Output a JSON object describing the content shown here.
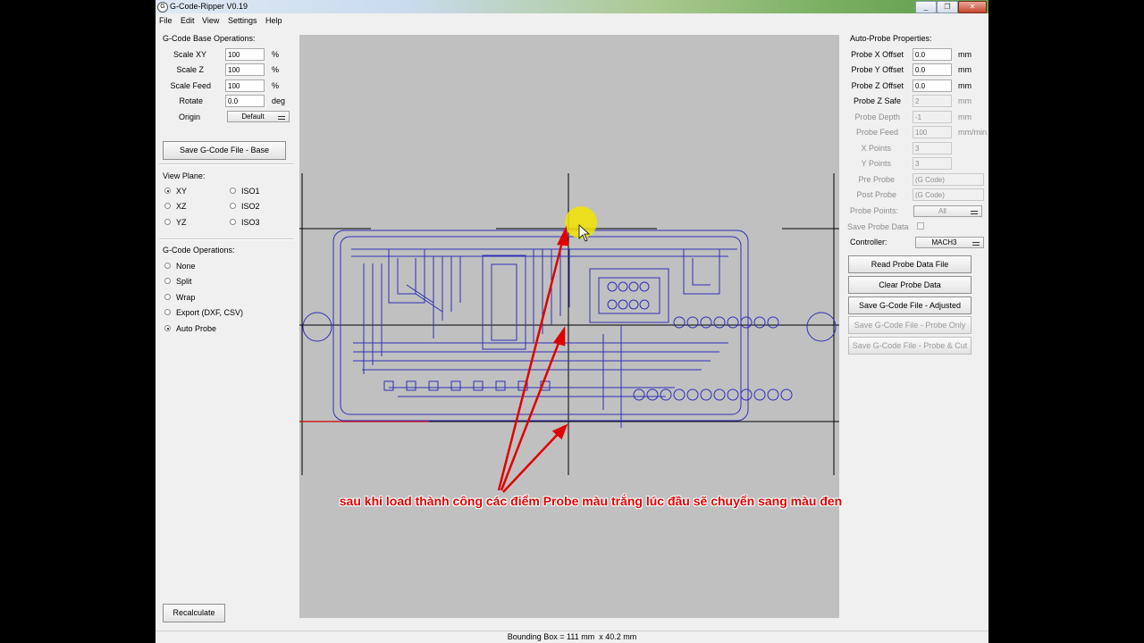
{
  "window": {
    "title": "G-Code-Ripper V0.19",
    "controls": [
      "_",
      "❐",
      "✕"
    ]
  },
  "menu": [
    "File",
    "Edit",
    "View",
    "Settings",
    "Help"
  ],
  "base_ops": {
    "heading": "G-Code Base Operations:",
    "rows": [
      {
        "label": "Scale XY",
        "value": "100",
        "unit": "%"
      },
      {
        "label": "Scale Z",
        "value": "100",
        "unit": "%"
      },
      {
        "label": "Scale Feed",
        "value": "100",
        "unit": "%"
      },
      {
        "label": "Rotate",
        "value": "0.0",
        "unit": "deg"
      }
    ],
    "origin_label": "Origin",
    "origin_value": "Default",
    "save_button": "Save G-Code File - Base"
  },
  "view_plane": {
    "heading": "View Plane:",
    "options": [
      {
        "label": "XY",
        "selected": true
      },
      {
        "label": "XZ",
        "selected": false
      },
      {
        "label": "YZ",
        "selected": false
      },
      {
        "label": "ISO1",
        "selected": false
      },
      {
        "label": "ISO2",
        "selected": false
      },
      {
        "label": "ISO3",
        "selected": false
      }
    ]
  },
  "gcode_ops": {
    "heading": "G-Code Operations:",
    "options": [
      {
        "label": "None",
        "selected": false
      },
      {
        "label": "Split",
        "selected": false
      },
      {
        "label": "Wrap",
        "selected": false
      },
      {
        "label": "Export (DXF, CSV)",
        "selected": false
      },
      {
        "label": "Auto Probe",
        "selected": true
      }
    ]
  },
  "recalculate_button": "Recalculate",
  "auto_probe": {
    "heading": "Auto-Probe Properties:",
    "rows": [
      {
        "label": "Probe X Offset",
        "value": "0.0",
        "unit": "mm",
        "enabled": true
      },
      {
        "label": "Probe Y Offset",
        "value": "0.0",
        "unit": "mm",
        "enabled": true
      },
      {
        "label": "Probe Z Offset",
        "value": "0.0",
        "unit": "mm",
        "enabled": true
      },
      {
        "label": "Probe Z Safe",
        "value": "2",
        "unit": "mm",
        "enabled": true,
        "field_disabled": true
      },
      {
        "label": "Probe Depth",
        "value": "-1",
        "unit": "mm",
        "enabled": false
      },
      {
        "label": "Probe Feed",
        "value": "100",
        "unit": "mm/min",
        "enabled": false
      },
      {
        "label": "X Points",
        "value": "3",
        "unit": "",
        "enabled": false
      },
      {
        "label": "Y Points",
        "value": "3",
        "unit": "",
        "enabled": false
      }
    ],
    "pre_probe_label": "Pre Probe",
    "pre_probe_value": "(G Code)",
    "post_probe_label": "Post Probe",
    "post_probe_value": "(G Code)",
    "probe_points_label": "Probe Points:",
    "probe_points_value": "All",
    "save_probe_data_label": "Save Probe Data",
    "controller_label": "Controller:",
    "controller_value": "MACH3",
    "buttons": [
      {
        "label": "Read Probe Data File",
        "enabled": true
      },
      {
        "label": "Clear Probe Data",
        "enabled": true
      },
      {
        "label": "Save G-Code File - Adjusted",
        "enabled": true
      },
      {
        "label": "Save G-Code File - Probe Only",
        "enabled": false
      },
      {
        "label": "Save G-Code File - Probe & Cut",
        "enabled": false
      }
    ]
  },
  "annotation": "sau khi load thành công các điểm Probe màu trắng lúc đầu sẽ chuyển sang màu đen",
  "status": "Bounding Box = 111 mm  x 40.2 mm",
  "colors": {
    "toolpath": "#2f2fb8",
    "annotation": "#e00000",
    "canvas": "#c0c0c0",
    "cursor_highlight": "#f2e300"
  }
}
